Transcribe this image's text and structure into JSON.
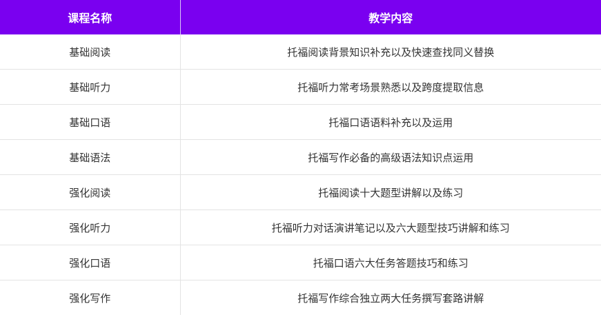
{
  "table": {
    "headers": [
      "课程名称",
      "教学内容"
    ],
    "rows": [
      {
        "name": "基础阅读",
        "content": "托福阅读背景知识补充以及快速查找同义替换"
      },
      {
        "name": "基础听力",
        "content": "托福听力常考场景熟悉以及跨度提取信息"
      },
      {
        "name": "基础口语",
        "content": "托福口语语料补充以及运用"
      },
      {
        "name": "基础语法",
        "content": "托福写作必备的高级语法知识点运用"
      },
      {
        "name": "强化阅读",
        "content": "托福阅读十大题型讲解以及练习"
      },
      {
        "name": "强化听力",
        "content": "托福听力对话演讲笔记以及六大题型技巧讲解和练习"
      },
      {
        "name": "强化口语",
        "content": "托福口语六大任务答题技巧和练习"
      },
      {
        "name": "强化写作",
        "content": "托福写作综合独立两大任务撰写套路讲解"
      }
    ]
  },
  "colors": {
    "header_bg": "#7a00f0",
    "header_text": "#ffffff",
    "body_text": "#333333",
    "grid_line": "#e3e3e3"
  }
}
